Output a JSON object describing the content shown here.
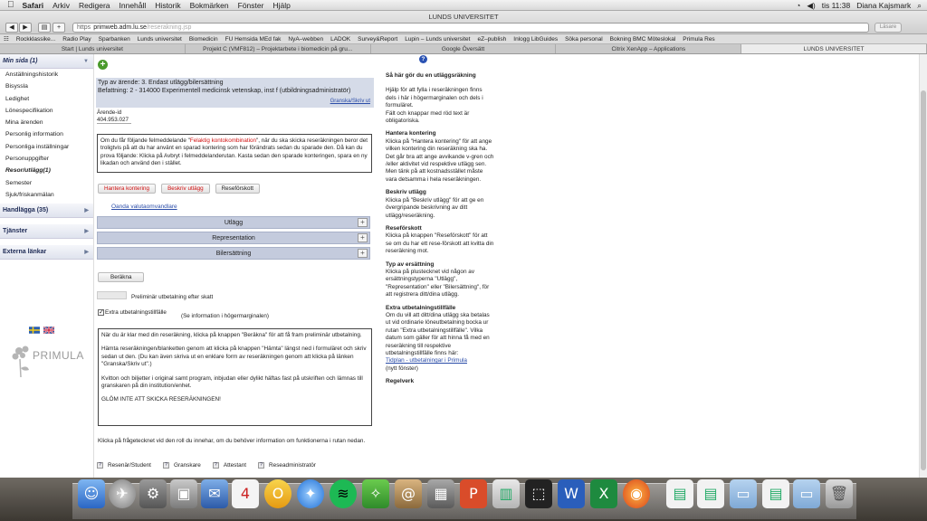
{
  "menubar": {
    "apple": "",
    "items": [
      "Safari",
      "Arkiv",
      "Redigera",
      "Innehåll",
      "Historik",
      "Bokmärken",
      "Fönster",
      "Hjälp"
    ],
    "clock": "tis 11:38",
    "user": "Diana Kajsmark"
  },
  "browser": {
    "window_title": "LUNDS UNIVERSITET",
    "url_prefix": "https",
    "url_host": "primweb.adm.lu.se",
    "url_path": "/reserakning.jsp",
    "reader_label": "Läsare"
  },
  "bookmarks": [
    "Rockklassike...",
    "Radio Play",
    "Sparbanken",
    "Lunds universitet",
    "Biomedicin",
    "FU Hemsida MEd fak",
    "NyA–webben",
    "LADOK",
    "Survey&Report",
    "Lupin – Lunds universitet",
    "eZ–publish",
    "Inlogg LibGuides",
    "Söka personal",
    "Bokning BMC Möteslokal",
    "Primula Res"
  ],
  "tabs": [
    "Start | Lunds universitet",
    "Projekt C (VMF812) – Projektarbete i biomedicin på gru...",
    "Google Översätt",
    "Citrix XenApp – Applications",
    "LUNDS UNIVERSITET"
  ],
  "sidebar": {
    "min_sida": "Min sida (1)",
    "items": [
      "Anställningshistorik",
      "Bisyssla",
      "Ledighet",
      "Lönespecifikation",
      "Mina ärenden",
      "Personlig information",
      "Personliga inställningar",
      "Personuppgifter",
      "Resor/utlägg(1)",
      "Semester",
      "Sjuk/friskanmälan"
    ],
    "handlagga": "Handlägga (35)",
    "tjanster": "Tjänster",
    "externa": "Externa länkar",
    "logo_text": "PRIMULA"
  },
  "main": {
    "type_line": "Typ av ärende: 3. Endast utlägg/bilersättning",
    "befattning": "Befattning: 2 - 314000 Experimentell medicinsk vetenskap, inst f (utbildningsadministratör)",
    "granska_link": "Granska/Skriv ut",
    "arende_label": "Ärende-id",
    "arende_value": "404.953.027",
    "error_pre": "Om du får följande felmeddelande \"",
    "error_red": "Felaktig kontokombination",
    "error_post": "\", när du ska skicka reseräkningen beror det troligtvis på att du har använt en sparad kontering som har förändrats sedan du sparade den. Då kan du prova följande: Klicka på Avbryt i felmeddelanderutan. Kasta sedan den sparade konteringen, spara en ny likadan och använd den i stället.",
    "btn_hantera": "Hantera kontering",
    "btn_beskriv": "Beskriv utlägg",
    "btn_reseforskott": "Reseförskott",
    "valuta_link": "Oanda valutaomvandlare",
    "acc_utlagg": "Utlägg",
    "acc_representation": "Representation",
    "acc_bil": "Bilersättning",
    "btn_berakna": "Beräkna",
    "prelim_label": "Preliminär utbetalning efter skatt",
    "extra_label": "Extra utbetalningstillfälle",
    "extra_info": "(Se information i högermarginalen)",
    "info_p1": "När du är klar med din reseräkning, klicka på knappen \"Beräkna\" för att få fram preliminär utbetalning.",
    "info_p2": "Hämta reseräkningen/blanketten genom att klicka på knappen \"Hämta\" längst ned i formuläret och skriv sedan ut den. (Du kan även skriva ut en enklare form av reseräkningen genom att klicka på länken \"Granska/Skriv ut\".)",
    "info_p3": "Kvitton och biljetter i original samt program, inbjudan eller dylikt häftas fast på utskriften och lämnas till granskaren på din institution/enhet.",
    "info_p4": "GLÖM INTE ATT SKICKA RESERÄKNINGEN!",
    "role_info": "Klicka på frågetecknet vid den roll du innehar, om du behöver information om funktionerna i rutan nedan.",
    "roles": [
      "Resenär/Student",
      "Granskare",
      "Attestant",
      "Reseadministratör"
    ]
  },
  "right": {
    "h1": "Så här gör du en utläggsräkning",
    "p1": "Hjälp för att fylla i reseräkningen finns dels i här i högermarginalen och dels i formuläret.",
    "p1b": "Fält och knappar med röd text är obligatoriska.",
    "h2": "Hantera kontering",
    "p2": "Klicka på \"Hantera kontering\" för att ange vilken kontering din reseräkning ska ha. Det går bra att ange avvikande v-gren och /eller aktivitet vid respektive utlägg sen. Men tänk på att kostnadsstället måste vara detsamma i hela reseräkningen.",
    "h3": "Beskriv utlägg",
    "p3": "Klicka på \"Beskriv utlägg\" för att ge en övergripande beskrivning av ditt utlägg/reseräkning.",
    "h4": "Reseförskott",
    "p4": "Klicka på knappen \"Reseförskott\" för att se om du har ett rese-förskott att kvitta din reseräkning mot.",
    "h5": "Typ av ersättning",
    "p5": "Klicka på plustecknet vid någon av ersättningstyperna \"Utlägg\", \"Representation\" eller \"Bilersättning\", för att registrera ditt/dina utlägg.",
    "h6": "Extra utbetalningstillfälle",
    "p6": "Om du vill att ditt/dina utlägg ska betalas ut vid ordinarie löneutbetalning bocka ur rutan \"Extra utbetalningstillfälle\". Vilka datum som gäller för att hinna få med en reseräkning till respektive utbetalningstillfälle finns här:",
    "link6": "Tidplan - utbetalningar i Primula",
    "p6b": "(nytt fönster)",
    "h7": "Regelverk"
  },
  "colors": {
    "accent_blue": "#2a4ca8",
    "required_red": "#d01010",
    "section_bar": "#c4cbdd"
  }
}
